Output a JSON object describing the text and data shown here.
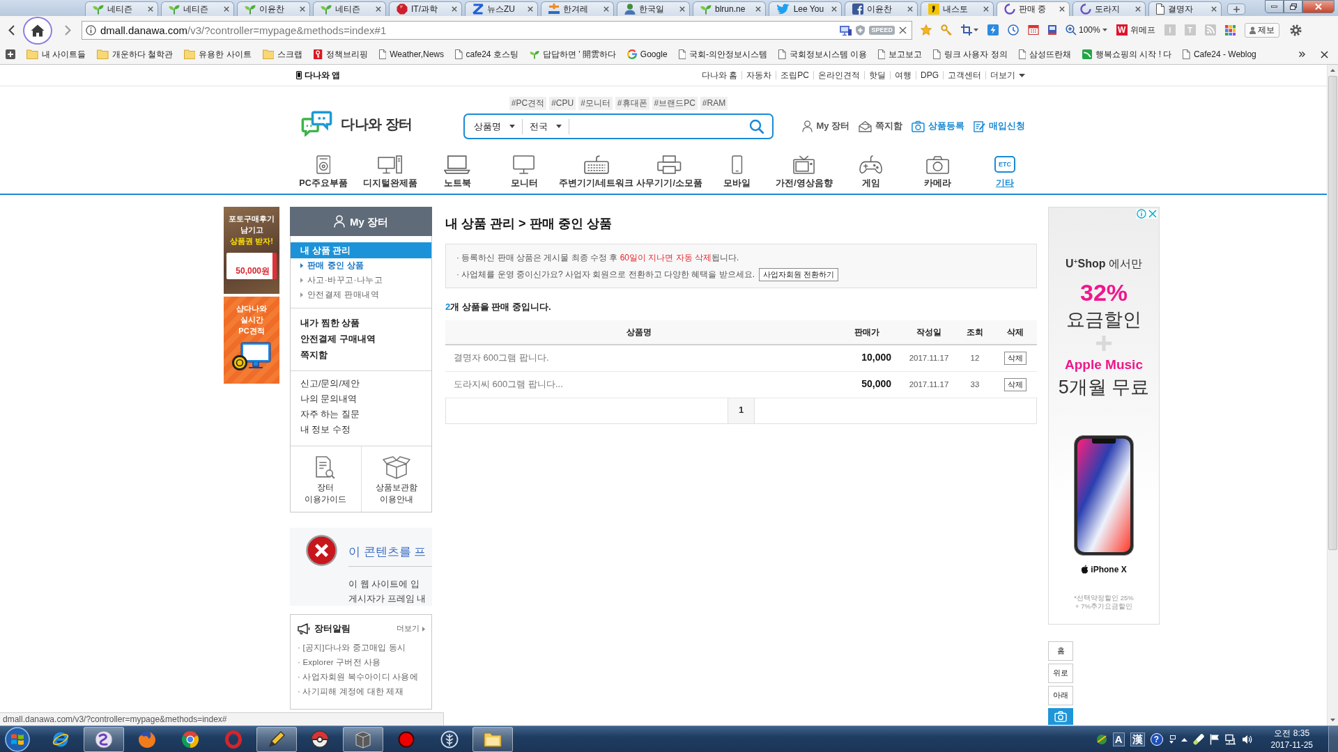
{
  "browser": {
    "tabs": [
      {
        "kind": "sprout",
        "label": "네티즌",
        "selected": false
      },
      {
        "kind": "sprout",
        "label": "네티즌",
        "selected": false
      },
      {
        "kind": "sprout",
        "label": "이윤찬",
        "selected": false
      },
      {
        "kind": "sprout",
        "label": "네티즌",
        "selected": false
      },
      {
        "kind": "gem",
        "label": "IT/과학",
        "selected": false
      },
      {
        "kind": "zigzag",
        "label": "뉴스ZU",
        "selected": false
      },
      {
        "kind": "bars",
        "label": "한겨레",
        "selected": false
      },
      {
        "kind": "person",
        "label": "한국일",
        "selected": false
      },
      {
        "kind": "sprout",
        "label": "blrun.ne",
        "selected": false
      },
      {
        "kind": "bird",
        "label": "Lee You",
        "selected": false
      },
      {
        "kind": "tile",
        "label": "이윤찬",
        "selected": false
      },
      {
        "kind": "quote",
        "label": "내스토",
        "selected": false
      },
      {
        "kind": "spinner",
        "label": "판매 중",
        "selected": true
      },
      {
        "kind": "spinner",
        "label": "도라지",
        "selected": false
      },
      {
        "kind": "page",
        "label": "결명자",
        "selected": false
      }
    ],
    "address": {
      "host": "dmall.danawa.com",
      "path": "/v3/?controller=mypage&methods=index#1",
      "badge": "SPEED"
    },
    "toolbar": {
      "zoom": "100%",
      "shop_logo": "W",
      "shop": "위메프",
      "tiles": [
        "I",
        "T"
      ],
      "report": "제보"
    },
    "bookmarks": [
      {
        "kind": "folder",
        "label": "내 사이트들"
      },
      {
        "kind": "folder",
        "label": "개운하다 철학관"
      },
      {
        "kind": "folder",
        "label": "유용한 사이트"
      },
      {
        "kind": "folder",
        "label": "스크랩"
      },
      {
        "kind": "key",
        "label": "정책브리핑"
      },
      {
        "kind": "page",
        "label": "Weather,News"
      },
      {
        "kind": "page",
        "label": "cafe24 호스팅"
      },
      {
        "kind": "sprout",
        "label": "답답하면 ' 開雲하다"
      },
      {
        "kind": "g",
        "label": "Google"
      },
      {
        "kind": "page",
        "label": "국회-의안정보시스템"
      },
      {
        "kind": "page",
        "label": "국회정보시스템 이용"
      },
      {
        "kind": "page",
        "label": "보고보고"
      },
      {
        "kind": "page",
        "label": "링크 사용자 정의"
      },
      {
        "kind": "page",
        "label": "삼성뜨란채"
      },
      {
        "kind": "stripe",
        "label": "행복쇼핑의 시작 ! 다"
      },
      {
        "kind": "page",
        "label": "Cafe24 - Weblog"
      }
    ],
    "status_url": "dmall.danawa.com/v3/?controller=mypage&methods=index#"
  },
  "site": {
    "app_link": "다나와 앱",
    "top_links": [
      {
        "label": "다나와 홈",
        "kind": "link"
      },
      {
        "label": "자동차",
        "kind": "link"
      },
      {
        "label": "조립PC",
        "kind": "link"
      },
      {
        "label": "온라인견적",
        "kind": "link"
      },
      {
        "label": "핫딜",
        "kind": "link"
      },
      {
        "label": "여행",
        "kind": "link"
      },
      {
        "label": "DPG",
        "kind": "link"
      },
      {
        "label": "고객센터",
        "kind": "link"
      },
      {
        "label": "더보기",
        "kind": "menu"
      }
    ],
    "hashtags": [
      "#PC견적",
      "#CPU",
      "#모니터",
      "#휴대폰",
      "#브랜드PC",
      "#RAM"
    ],
    "logo": "다나와 장터",
    "search": {
      "field": "상품명",
      "region": "전국"
    },
    "user_links": [
      {
        "kind": "person",
        "label": "My 장터",
        "accent": false
      },
      {
        "kind": "message",
        "label": "쪽지함",
        "accent": false
      },
      {
        "kind": "camera",
        "label": "상품등록",
        "accent": true
      },
      {
        "kind": "form",
        "label": "매입신청",
        "accent": true
      }
    ],
    "categories": [
      {
        "kind": "parts",
        "label": "PC주요부품",
        "selected": false
      },
      {
        "kind": "desktop",
        "label": "디지털완제품",
        "selected": false
      },
      {
        "kind": "laptop",
        "label": "노트북",
        "selected": false
      },
      {
        "kind": "monitor",
        "label": "모니터",
        "selected": false
      },
      {
        "kind": "keyboard",
        "label": "주변기기/네트워크",
        "selected": false
      },
      {
        "kind": "printer",
        "label": "사무기기/소모품",
        "selected": false
      },
      {
        "kind": "mobile",
        "label": "모바일",
        "selected": false
      },
      {
        "kind": "tv",
        "label": "가전/영상음향",
        "selected": false
      },
      {
        "kind": "gamepad",
        "label": "게임",
        "selected": false
      },
      {
        "kind": "camera",
        "label": "카메라",
        "selected": false
      },
      {
        "kind": "etc",
        "label": "기타",
        "icon_text": "ETC",
        "selected": true
      }
    ]
  },
  "banners": [
    {
      "kind": "review",
      "lines": [
        "포토구매후기",
        "남기고"
      ],
      "highlight": "상품권 받자!",
      "voucher": "50,000원"
    },
    {
      "kind": "estimate",
      "lines": [
        "샵다나와",
        "실시간",
        "PC견적"
      ]
    }
  ],
  "sidebar": {
    "title": "My 장터",
    "sections": [
      {
        "kind": "manage",
        "heading": {
          "label": "내 상품 관리",
          "selected": true
        },
        "items": [
          {
            "label": "판매 중인 상품",
            "selected": true
          },
          {
            "label": "사고·바꾸고·나누고",
            "selected": false
          },
          {
            "label": "안전결제 판매내역",
            "selected": false
          }
        ]
      },
      {
        "kind": "bold",
        "items": [
          {
            "label": "내가 찜한 상품",
            "selected": false
          },
          {
            "label": "안전결제 구매내역",
            "selected": false
          },
          {
            "label": "쪽지함",
            "selected": false
          }
        ]
      },
      {
        "kind": "plain",
        "items": [
          {
            "label": "신고/문의/제안",
            "selected": false
          },
          {
            "label": "나의 문의내역",
            "selected": false
          },
          {
            "label": "자주 하는 질문",
            "selected": false
          },
          {
            "label": "내 정보 수정",
            "selected": false
          }
        ]
      }
    ],
    "guides": [
      {
        "kind": "guide",
        "lines": [
          "장터",
          "이용가이드"
        ]
      },
      {
        "kind": "storage",
        "lines": [
          "상품보관함",
          "이용안내"
        ]
      }
    ],
    "error_frame": {
      "heading": "이 콘텐츠를 프",
      "lines": [
        "이 웹 사이트에 입",
        "게시자가 프레임 내"
      ]
    },
    "notices": {
      "title": "장터알림",
      "more": "더보기",
      "items": [
        "· [공지]다나와 중고매입 동시",
        "· Explorer 구버전 사용",
        "· 사업자회원 복수아이디 사용에",
        "· 사기피해 계정에 대한 제재"
      ]
    }
  },
  "main": {
    "breadcrumb": "내 상품 관리 > 판매 중인 상품",
    "notice": [
      {
        "parts": [
          {
            "text": "· 등록하신 판매 상품은 게시물 최종 수정 후 ",
            "highlight": false
          },
          {
            "text": "60일이 지나면 자동 삭제",
            "highlight": true
          },
          {
            "text": "됩니다.",
            "highlight": false
          }
        ]
      },
      {
        "parts": [
          {
            "text": "· 사업체를 운영 중이신가요? 사업자 회원으로 전환하고 다양한 혜택을 받으세요.",
            "highlight": false
          }
        ],
        "button": "사업자회원 전환하기"
      }
    ],
    "count": {
      "number": "2",
      "text": "개 상품을 판매 중입니다."
    },
    "table": {
      "columns": [
        "상품명",
        "판매가",
        "작성일",
        "조회",
        "삭제"
      ],
      "rows": [
        {
          "name": "결명자 600그램 팝니다.",
          "price": "10,000",
          "date": "2017.11.17",
          "views": "12",
          "action": "삭제"
        },
        {
          "name": "도라지씨 600그램 팝니다...",
          "price": "50,000",
          "date": "2017.11.17",
          "views": "33",
          "action": "삭제"
        }
      ]
    },
    "pages": [
      {
        "label": "1",
        "selected": true
      }
    ]
  },
  "ad": {
    "headline": "**U**$^{+}$**Shop** 에서만",
    "lines": [
      {
        "kind": "accent-xl",
        "text": "32%"
      },
      {
        "kind": "xl",
        "text": "요금할인"
      },
      {
        "kind": "plus"
      },
      {
        "kind": "accent",
        "text": "Apple Music"
      },
      {
        "kind": "xl",
        "text": "5개월 무료"
      }
    ],
    "product": "iPhone X",
    "footnote": [
      "*선택약정할인 25%",
      "+ 7%추가요금할인"
    ]
  },
  "quick_buttons": [
    {
      "kind": "text",
      "label": "홈"
    },
    {
      "kind": "text",
      "label": "위로"
    },
    {
      "kind": "text",
      "label": "아래"
    },
    {
      "kind": "camera"
    }
  ],
  "taskbar": {
    "apps": [
      {
        "kind": "ie",
        "active": false
      },
      {
        "kind": "orb",
        "active": true
      },
      {
        "kind": "firefox",
        "active": false
      },
      {
        "kind": "chrome",
        "active": false
      },
      {
        "kind": "opera",
        "active": false
      },
      {
        "kind": "pen",
        "active": true
      },
      {
        "kind": "ball",
        "active": false
      },
      {
        "kind": "book",
        "active": true
      },
      {
        "kind": "record",
        "active": false
      },
      {
        "kind": "leaf",
        "active": false
      },
      {
        "kind": "folder",
        "active": true
      }
    ],
    "ime": [
      "A",
      "漢"
    ],
    "help": "?",
    "time": "오전 8:35",
    "date": "2017-11-25"
  }
}
